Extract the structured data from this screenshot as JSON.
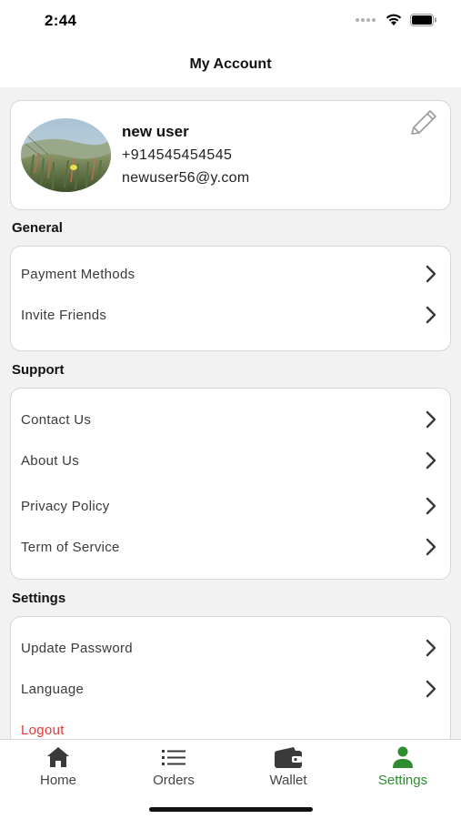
{
  "status_bar": {
    "time": "2:44"
  },
  "header": {
    "title": "My Account"
  },
  "profile": {
    "name": "new user",
    "phone": "+914545454545",
    "email": "newuser56@y.com"
  },
  "sections": {
    "general": {
      "title": "General",
      "items": [
        {
          "label": "Payment Methods"
        },
        {
          "label": "Invite Friends"
        }
      ]
    },
    "support": {
      "title": "Support",
      "items": [
        {
          "label": "Contact Us"
        },
        {
          "label": "About Us"
        },
        {
          "label": "Privacy Policy"
        },
        {
          "label": "Term of Service"
        }
      ]
    },
    "settings": {
      "title": "Settings",
      "items": [
        {
          "label": "Update Password"
        },
        {
          "label": "Language"
        },
        {
          "label": "Logout"
        }
      ]
    }
  },
  "tab_bar": {
    "tabs": [
      {
        "label": "Home",
        "icon": "home-icon"
      },
      {
        "label": "Orders",
        "icon": "list-icon"
      },
      {
        "label": "Wallet",
        "icon": "wallet-icon"
      },
      {
        "label": "Settings",
        "icon": "user-icon"
      }
    ],
    "active": "Settings"
  },
  "colors": {
    "accent": "#2e8b2e",
    "logout": "#e53935",
    "background": "#f2f2f2"
  }
}
